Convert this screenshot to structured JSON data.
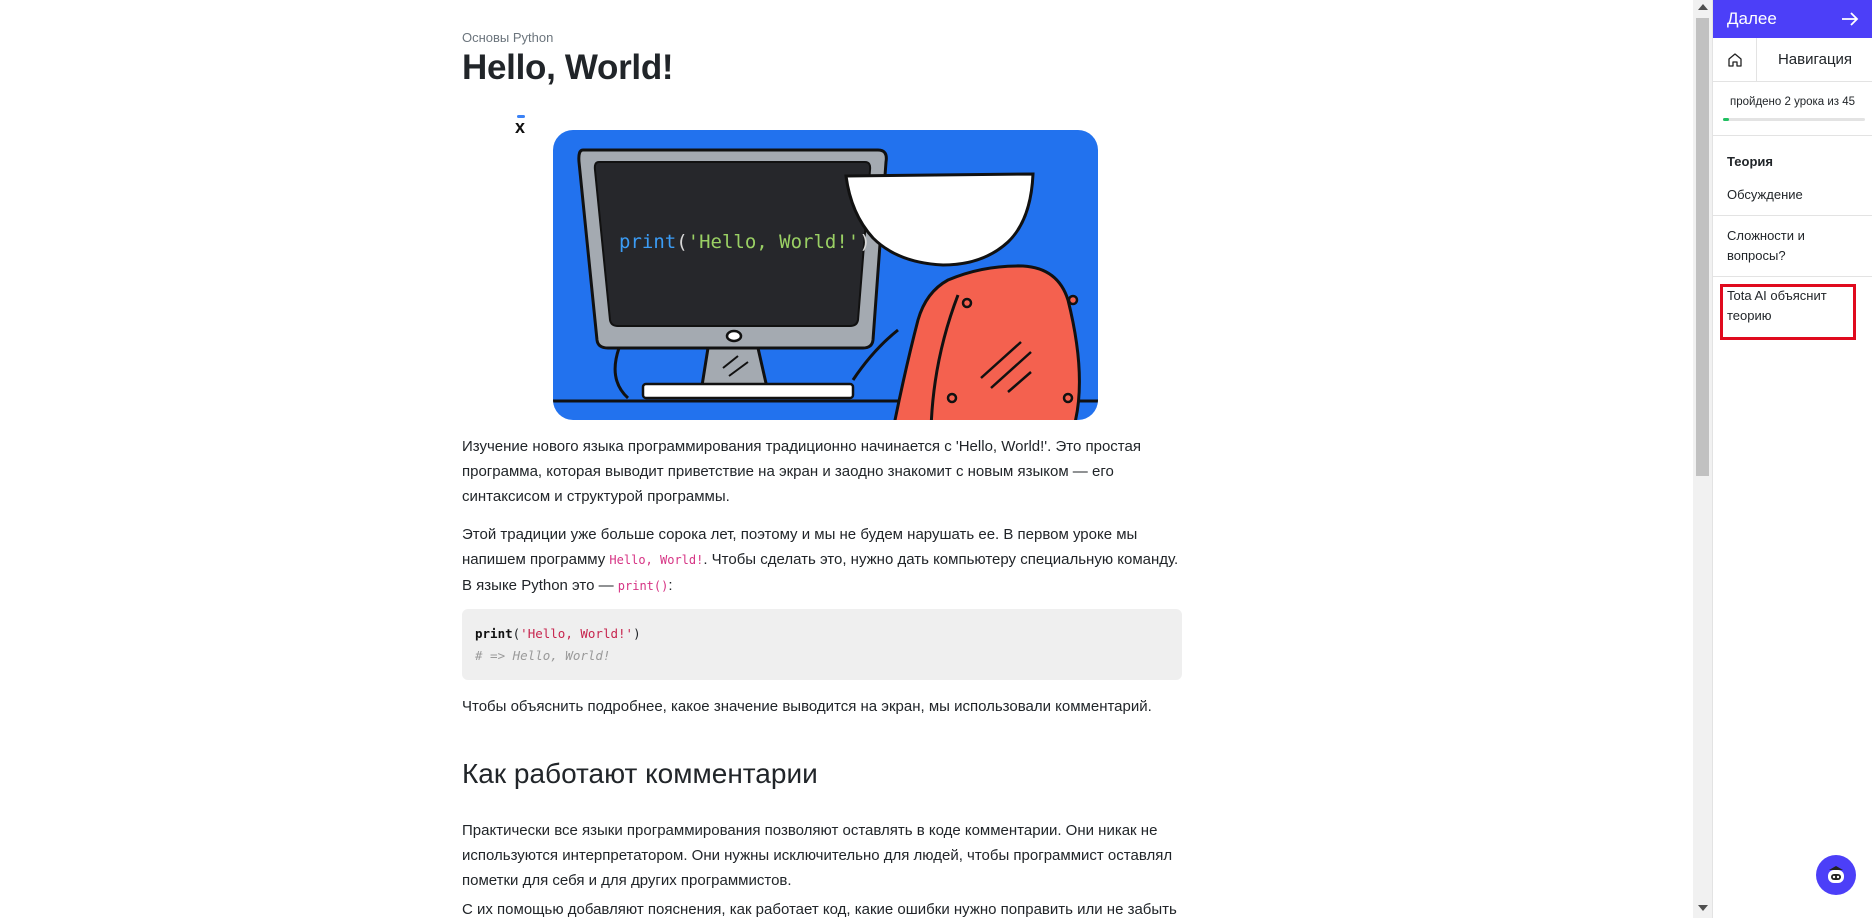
{
  "lesson": {
    "breadcrumb": "Основы Python",
    "title": "Hello, World!",
    "close_label": "x",
    "illustration_code": {
      "fn": "print",
      "open": "(",
      "str": "'Hello, World!'",
      "close": ")"
    },
    "paragraph1": "Изучение нового языка программирования традиционно начинается с 'Hello, World!'. Это простая программа, которая выводит приветствие на экран и заодно знакомит с новым языком — его синтаксисом и структурой программы.",
    "paragraph2": {
      "part1": "Этой традиции уже больше сорока лет, поэтому и мы не будем нарушать ее. В первом уроке мы напишем программу ",
      "code1": "Hello, World!",
      "part2": ". Чтобы сделать это, нужно дать компьютеру специальную команду. В языке Python это — ",
      "code2": "print()",
      "part3": ":"
    },
    "code_block": {
      "line1_fn": "print",
      "line1_open": "(",
      "line1_str": "'Hello, World!'",
      "line1_close": ")",
      "line2_comment": "# => Hello, World!"
    },
    "paragraph3": "Чтобы объяснить подробнее, какое значение выводится на экран, мы использовали комментарий.",
    "section_title": "Как работают комментарии",
    "paragraph4": "Практически все языки программирования позволяют оставлять в коде комментарии. Они никак не используются интерпретатором. Они нужны исключительно для людей, чтобы программист оставлял пометки для себя и для других программистов.",
    "paragraph5": "С их помощью добавляют пояснения, как работает код, какие ошибки нужно поправить или не забыть"
  },
  "sidebar": {
    "next_label": "Далее",
    "next_icon": "arrow-right-icon",
    "home_icon": "home-icon",
    "nav_label": "Навигация",
    "progress_text": "пройдено 2 урока из 45",
    "progress_fraction": 0.044,
    "items": {
      "theory": "Теория",
      "discussion": "Обсуждение",
      "hard": "Сложности и вопросы?",
      "ai": "Tota AI объяснит теорию"
    }
  },
  "colors": {
    "accent": "#4c3ff8",
    "illustration_bg": "#2272ee",
    "chair": "#f4614f",
    "highlight": "#e00a1e",
    "progress": "#20c060"
  }
}
